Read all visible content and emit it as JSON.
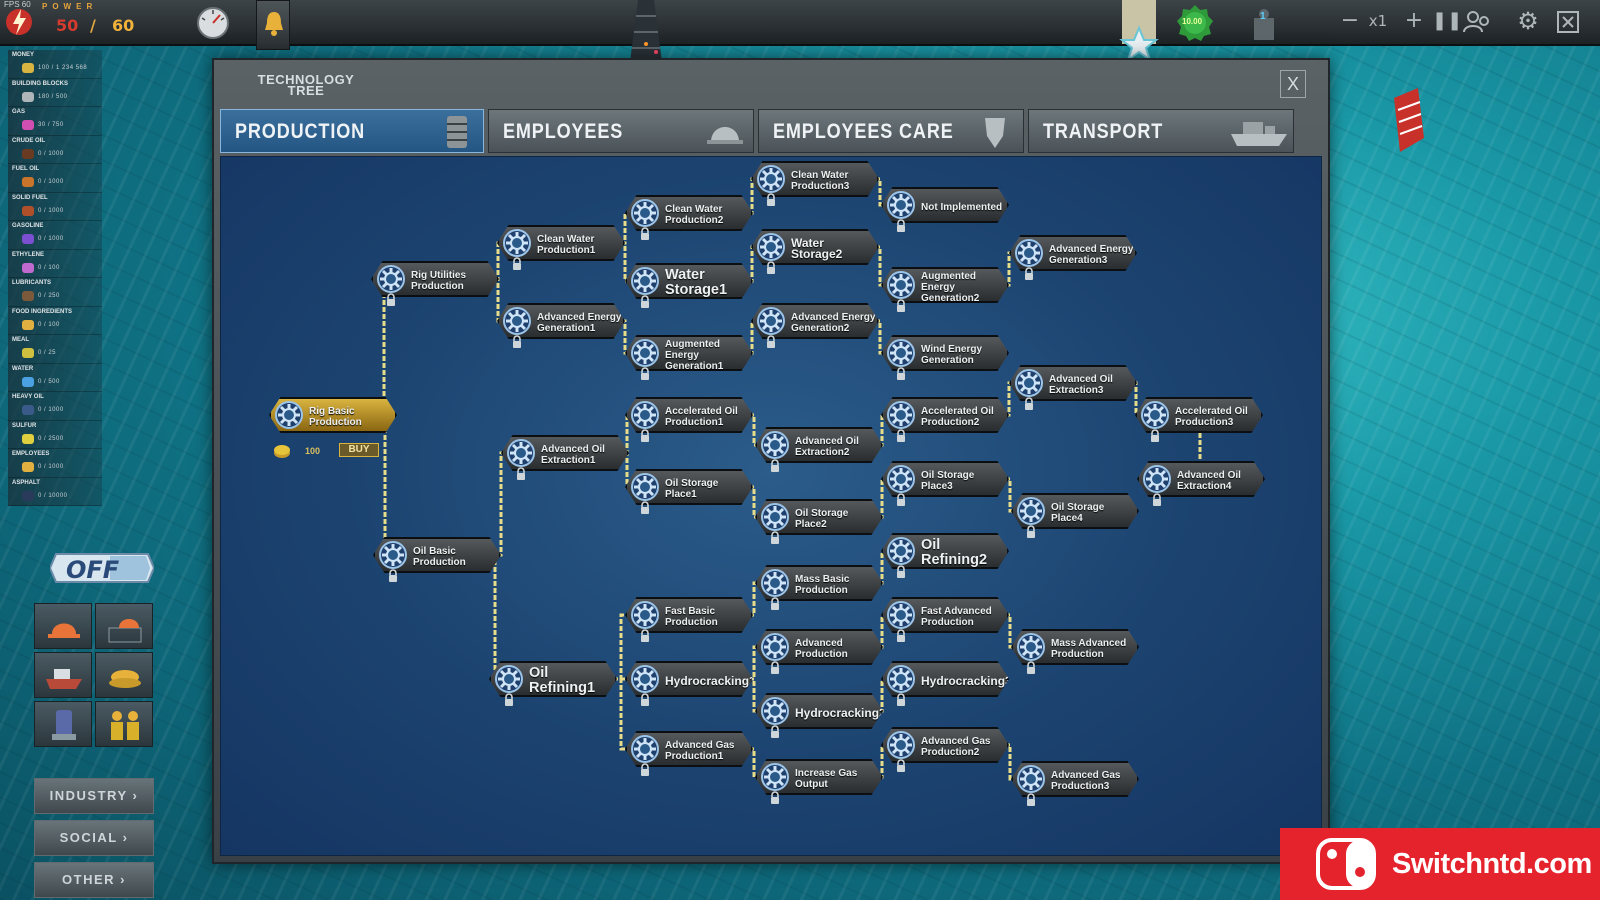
{
  "hud": {
    "fps": "FPS 60",
    "power_title": "POWER",
    "power_current": "50",
    "power_sep": "/",
    "power_max": "60",
    "speed": "x1",
    "green_badge_value": "10.00",
    "worker_count": "1"
  },
  "resources": [
    {
      "name": "MONEY",
      "value": "100 / 1 234 568",
      "color": "#d9b440"
    },
    {
      "name": "BUILDING BLOCKS",
      "value": "180 / 500",
      "color": "#aeb6ba"
    },
    {
      "name": "GAS",
      "value": "30 / 750",
      "color": "#d04fb0"
    },
    {
      "name": "CRUDE OIL",
      "value": "0 / 1000",
      "color": "#6a3a22"
    },
    {
      "name": "FUEL OIL",
      "value": "0 / 1000",
      "color": "#c8742a"
    },
    {
      "name": "SOLID FUEL",
      "value": "0 / 1000",
      "color": "#b0502a"
    },
    {
      "name": "GASOLINE",
      "value": "0 / 1000",
      "color": "#7a4fd0"
    },
    {
      "name": "ETHYLENE",
      "value": "0 / 100",
      "color": "#c06ad0"
    },
    {
      "name": "LUBRICANTS",
      "value": "0 / 250",
      "color": "#7a5a3a"
    },
    {
      "name": "FOOD INGREDIENTS",
      "value": "0 / 100",
      "color": "#e0b040"
    },
    {
      "name": "MEAL",
      "value": "0 / 25",
      "color": "#d0c040"
    },
    {
      "name": "WATER",
      "value": "0 / 500",
      "color": "#4aa0e0"
    },
    {
      "name": "HEAVY OIL",
      "value": "0 / 1000",
      "color": "#3a5a8a"
    },
    {
      "name": "SULFUR",
      "value": "0 / 2500",
      "color": "#e0d040"
    },
    {
      "name": "EMPLOYEES",
      "value": "0 / 1000",
      "color": "#e0b040"
    },
    {
      "name": "ASPHALT",
      "value": "0 / 10000",
      "color": "#2a3a5a"
    }
  ],
  "off_label": "OFF",
  "nav": {
    "industry": "INDUSTRY ›",
    "social": "SOCIAL ›",
    "other": "OTHER ›"
  },
  "panel": {
    "title": "TECHNOLOGY TREE",
    "close": "X",
    "tabs": [
      {
        "label": "PRODUCTION",
        "active": true
      },
      {
        "label": "EMPLOYEES",
        "active": false
      },
      {
        "label": "EMPLOYEES CARE",
        "active": false
      },
      {
        "label": "TRANSPORT",
        "active": false
      }
    ],
    "buy_cost": "100",
    "buy_label": "BUY"
  },
  "tech_nodes": {
    "rig_basic": "Rig Basic Production",
    "rig_utilities": "Rig Utilities Production",
    "oil_basic": "Oil Basic Production",
    "clean_water1": "Clean Water Production1",
    "clean_water2": "Clean Water Production2",
    "clean_water3": "Clean Water Production3",
    "not_implemented": "Not Implemented",
    "water_storage1": "Water Storage1",
    "water_storage2": "Water Storage2",
    "adv_energy1": "Advanced Energy Generation1",
    "adv_energy2": "Advanced Energy Generation2",
    "adv_energy3": "Advanced Energy Generation3",
    "aug_energy1": "Augmented Energy Generation1",
    "aug_energy2": "Augmented Energy Generation2",
    "wind_energy": "Wind Energy Generation",
    "adv_oil1": "Advanced Oil Extraction1",
    "adv_oil2": "Advanced Oil Extraction2",
    "adv_oil3": "Advanced Oil Extraction3",
    "adv_oil4": "Advanced Oil Extraction4",
    "acc_oil1": "Accelerated Oil Production1",
    "acc_oil2": "Accelerated Oil Production2",
    "acc_oil3": "Accelerated Oil Production3",
    "oil_storage1": "Oil Storage Place1",
    "oil_storage2": "Oil Storage Place2",
    "oil_storage3": "Oil Storage Place3",
    "oil_storage4": "Oil Storage Place4",
    "oil_refining1": "Oil Refining1",
    "oil_refining2": "Oil Refining2",
    "mass_basic": "Mass Basic Production",
    "mass_advanced": "Mass Advanced Production",
    "fast_basic": "Fast Basic Production",
    "fast_advanced": "Fast Advanced Production",
    "advanced_production": "Advanced Production",
    "hydrocracking1": "Hydrocracking1",
    "hydrocracking2": "Hydrocracking2",
    "hydrocracking3": "Hydrocracking3",
    "adv_gas1": "Advanced Gas Production1",
    "adv_gas2": "Advanced Gas Production2",
    "adv_gas3": "Advanced Gas Production3",
    "increase_gas": "Increase Gas Output"
  },
  "watermark": "Switchntd.com"
}
